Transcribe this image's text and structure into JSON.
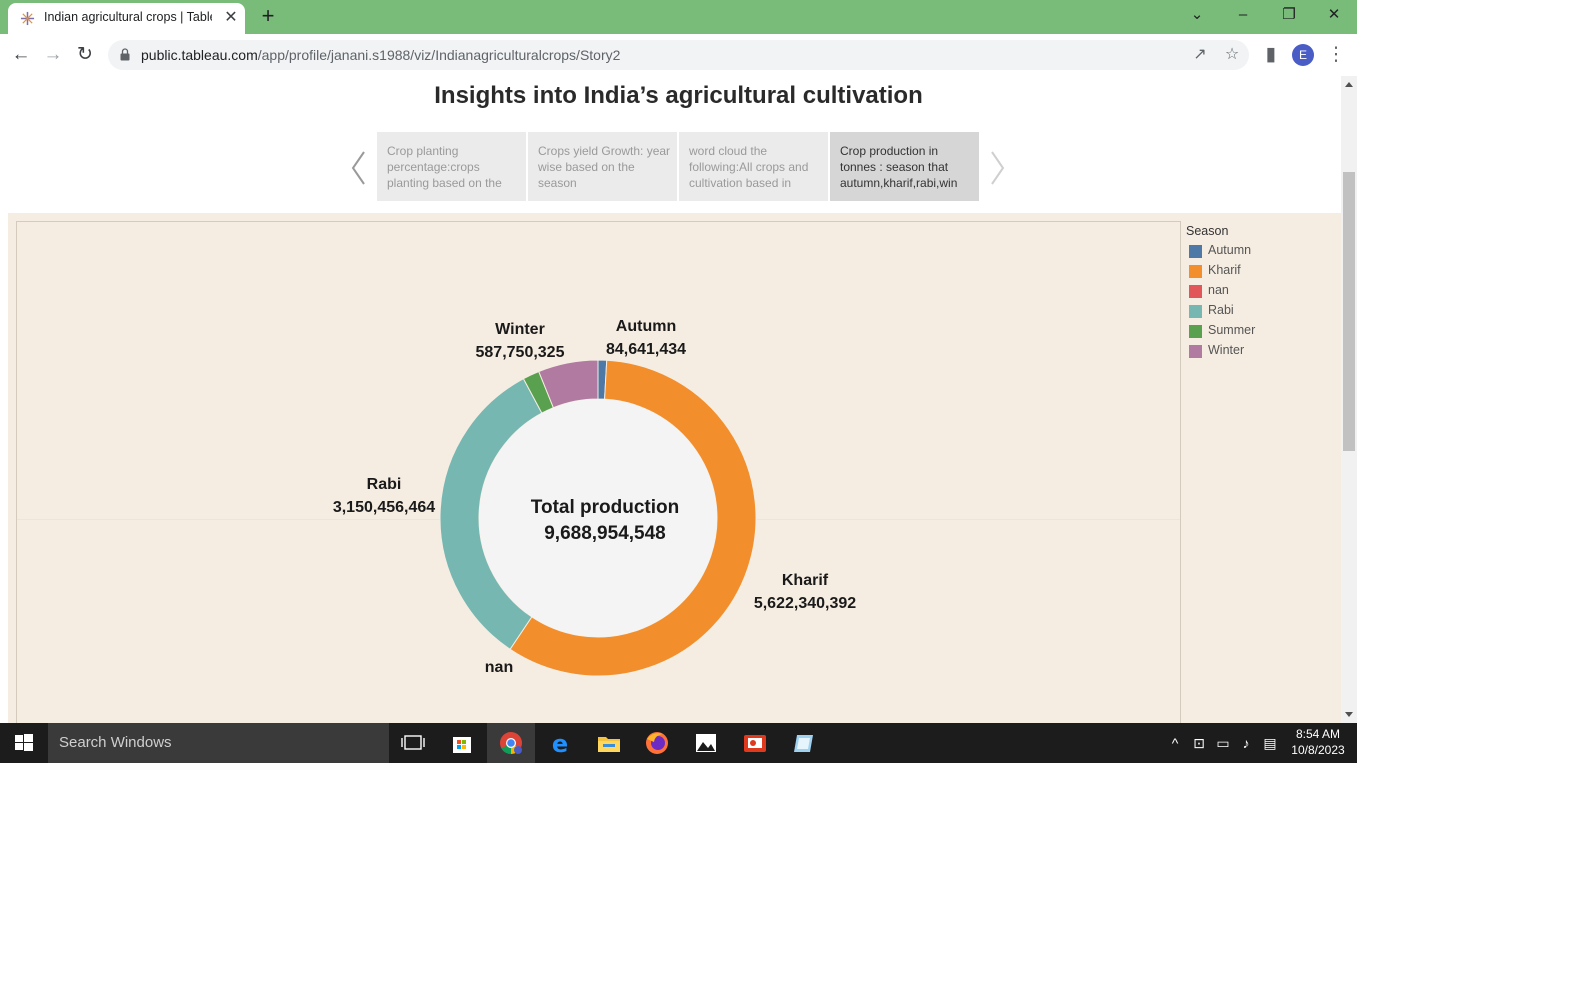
{
  "browser": {
    "tab_title": "Indian agricultural crops | Tableau Public",
    "url_host": "public.tableau.com",
    "url_path": "/app/profile/janani.s1988/viz/Indianagriculturalcrops/Story2",
    "profile_initial": "E"
  },
  "story": {
    "title": "Insights into India’s agricultural cultivation",
    "points": [
      {
        "text": "Crop planting percentage:crops planting based on the"
      },
      {
        "text": "Crops yield Growth: year wise based on the season"
      },
      {
        "text": "word cloud the following:All crops and cultivation based in"
      },
      {
        "text": "Crop production in tonnes : season that autumn,kharif,rabi,win"
      }
    ]
  },
  "chart_data": {
    "type": "pie",
    "style": "donut",
    "center_label": "Total production",
    "total": 9688954548,
    "total_text": "9,688,954,548",
    "legend_title": "Season",
    "legend_position": "right",
    "slices": [
      {
        "name": "Autumn",
        "value": 84641434,
        "value_text": "84,641,434",
        "color": "#4e79a7"
      },
      {
        "name": "Kharif",
        "value": 5622340392,
        "value_text": "5,622,340,392",
        "color": "#f28e2b"
      },
      {
        "name": "nan",
        "value": 0,
        "value_text": "",
        "color": "#e15759"
      },
      {
        "name": "Rabi",
        "value": 3150456464,
        "value_text": "3,150,456,464",
        "color": "#76b7b2"
      },
      {
        "name": "Summer",
        "value": 163766000,
        "value_text": "",
        "color": "#59a14f"
      },
      {
        "name": "Winter",
        "value": 587750325,
        "value_text": "587,750,325",
        "color": "#b07aa1"
      }
    ]
  },
  "taskbar": {
    "search_placeholder": "Search Windows",
    "time": "8:54 AM",
    "date": "10/8/2023"
  }
}
